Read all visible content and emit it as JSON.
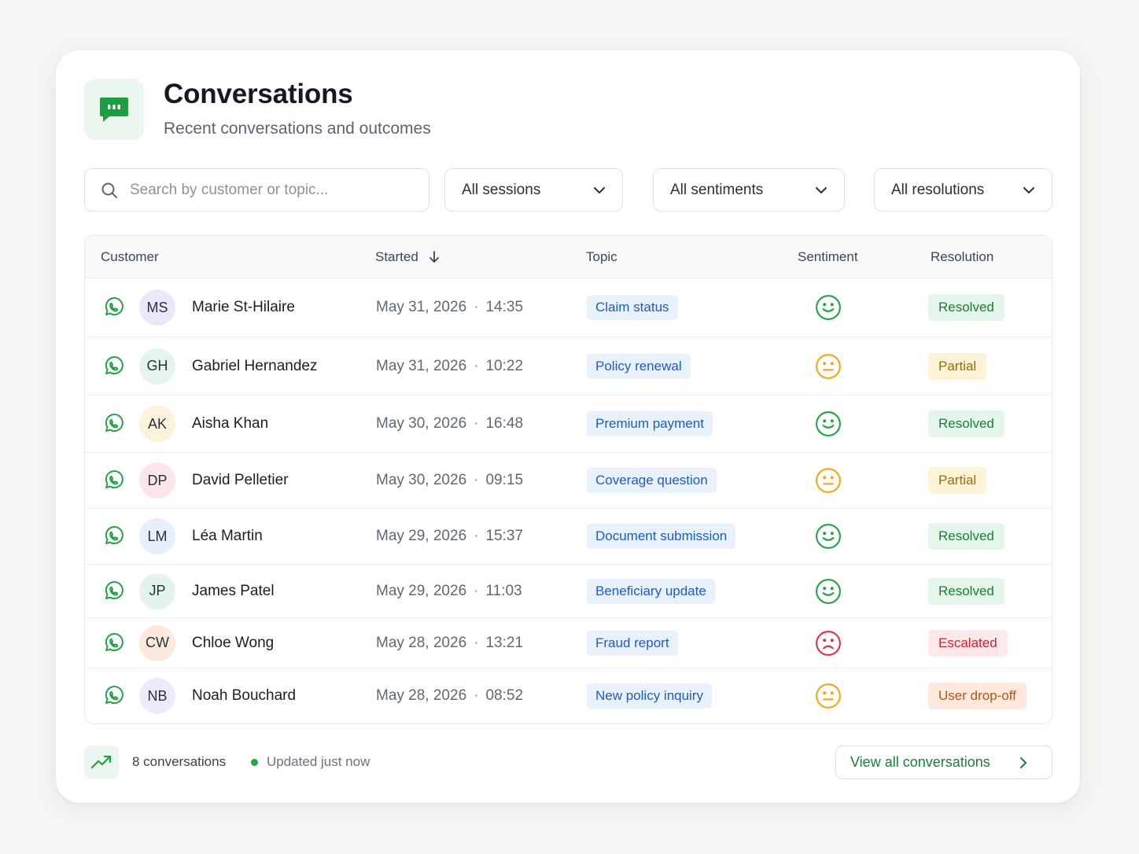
{
  "header": {
    "icon": "chat-bubble-icon",
    "title": "Conversations",
    "subtitle": "Recent conversations and outcomes"
  },
  "filters": {
    "search_placeholder": "Search by customer or topic...",
    "sessions": "All sessions",
    "sentiments": "All sentiments",
    "resolutions": "All resolutions"
  },
  "table": {
    "columns": {
      "customer": "Customer",
      "started": "Started",
      "topic": "Topic",
      "sentiment": "Sentiment",
      "resolution": "Resolution"
    },
    "sort": {
      "column": "started",
      "direction": "descending"
    },
    "rows": [
      {
        "channel": "whatsapp-icon",
        "initials": "MS",
        "avatar_bg": "#ece8fb",
        "name": "Marie St-Hilaire",
        "date": "May 31, 2026",
        "time": "14:35",
        "topic": "Claim status",
        "sentiment": "positive",
        "resolution": "Resolved"
      },
      {
        "channel": "whatsapp-icon",
        "initials": "GH",
        "avatar_bg": "#e5f5ec",
        "name": "Gabriel Hernandez",
        "date": "May 31, 2026",
        "time": "10:22",
        "topic": "Policy renewal",
        "sentiment": "neutral",
        "resolution": "Partial"
      },
      {
        "channel": "whatsapp-icon",
        "initials": "AK",
        "avatar_bg": "#fdf3dc",
        "name": "Aisha Khan",
        "date": "May 30, 2026",
        "time": "16:48",
        "topic": "Premium payment",
        "sentiment": "positive",
        "resolution": "Resolved"
      },
      {
        "channel": "whatsapp-icon",
        "initials": "DP",
        "avatar_bg": "#fde6ea",
        "name": "David Pelletier",
        "date": "May 30, 2026",
        "time": "09:15",
        "topic": "Coverage question",
        "sentiment": "neutral",
        "resolution": "Partial"
      },
      {
        "channel": "whatsapp-icon",
        "initials": "LM",
        "avatar_bg": "#e6effc",
        "name": "Léa Martin",
        "date": "May 29, 2026",
        "time": "15:37",
        "topic": "Document submission",
        "sentiment": "positive",
        "resolution": "Resolved"
      },
      {
        "channel": "whatsapp-icon",
        "initials": "JP",
        "avatar_bg": "#e3f4ef",
        "name": "James Patel",
        "date": "May 29, 2026",
        "time": "11:03",
        "topic": "Beneficiary update",
        "sentiment": "positive",
        "resolution": "Resolved"
      },
      {
        "channel": "whatsapp-icon",
        "initials": "CW",
        "avatar_bg": "#fde9dd",
        "name": "Chloe Wong",
        "date": "May 28, 2026",
        "time": "13:21",
        "topic": "Fraud report",
        "sentiment": "negative",
        "resolution": "Escalated"
      },
      {
        "channel": "whatsapp-icon",
        "initials": "NB",
        "avatar_bg": "#ecebfb",
        "name": "Noah Bouchard",
        "date": "May 28, 2026",
        "time": "08:52",
        "topic": "New policy inquiry",
        "sentiment": "neutral",
        "resolution": "User drop-off"
      }
    ]
  },
  "footer": {
    "icon": "trend-up-icon",
    "count": "8 conversations",
    "updated": "Updated just now",
    "view_all": "View all conversations"
  },
  "colors": {
    "brand_green": "#1f9d43",
    "whatsapp_green": "#25a244",
    "sentiment_positive": "#22a447",
    "sentiment_neutral": "#f2a813",
    "sentiment_negative": "#e0343d",
    "resolved_bg": "#e4f5e9",
    "resolved_fg": "#1d7d39",
    "partial_bg": "#fdf3d6",
    "partial_fg": "#9a6a06",
    "escalated_bg": "#fde8ea",
    "escalated_fg": "#d3232f",
    "dropoff_bg": "#fdeadc",
    "dropoff_fg": "#c4500e"
  }
}
